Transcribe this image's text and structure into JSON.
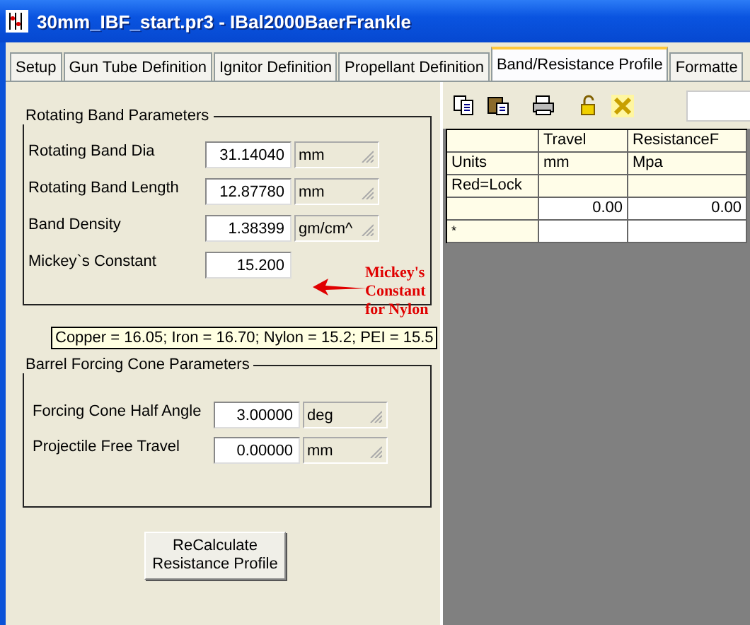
{
  "window": {
    "title": "30mm_IBF_start.pr3 - IBal2000BaerFrankle"
  },
  "tabs": [
    {
      "label": "Setup",
      "selected": false
    },
    {
      "label": "Gun Tube Definition",
      "selected": false
    },
    {
      "label": "Ignitor Definition",
      "selected": false
    },
    {
      "label": "Propellant Definition",
      "selected": false
    },
    {
      "label": "Band/Resistance Profile",
      "selected": true
    },
    {
      "label": "Formatte",
      "selected": false
    }
  ],
  "rotating_band": {
    "title": "Rotating Band Parameters",
    "fields": [
      {
        "label": "Rotating Band Dia",
        "value": "31.14040",
        "unit": "mm"
      },
      {
        "label": "Rotating Band Length",
        "value": "12.87780",
        "unit": "mm"
      },
      {
        "label": "Band Density",
        "value": "1.38399",
        "unit": "gm/cm^"
      },
      {
        "label": "Mickey`s Constant",
        "value": "15.200"
      }
    ]
  },
  "annotation": {
    "text": "Mickey's\nConstant\nfor Nylon"
  },
  "tooltip": {
    "text": "Copper = 16.05; Iron = 16.70; Nylon = 15.2; PEI = 15.5"
  },
  "forcing_cone": {
    "title": "Barrel Forcing Cone Parameters",
    "fields": [
      {
        "label": "Forcing Cone Half Angle",
        "value": "3.00000",
        "unit": "deg"
      },
      {
        "label": "Projectile Free Travel",
        "value": "0.00000",
        "unit": "mm"
      }
    ]
  },
  "button": {
    "label": "ReCalculate\nResistance Profile"
  },
  "grid": {
    "columns": [
      "Travel",
      "ResistanceF"
    ],
    "rows": [
      {
        "header": "Units",
        "cells": [
          "mm",
          "Mpa"
        ]
      },
      {
        "header": "Red=Lock"
      },
      {
        "cells": [
          "0.00",
          "0.00"
        ]
      },
      {
        "header": "*"
      }
    ]
  }
}
